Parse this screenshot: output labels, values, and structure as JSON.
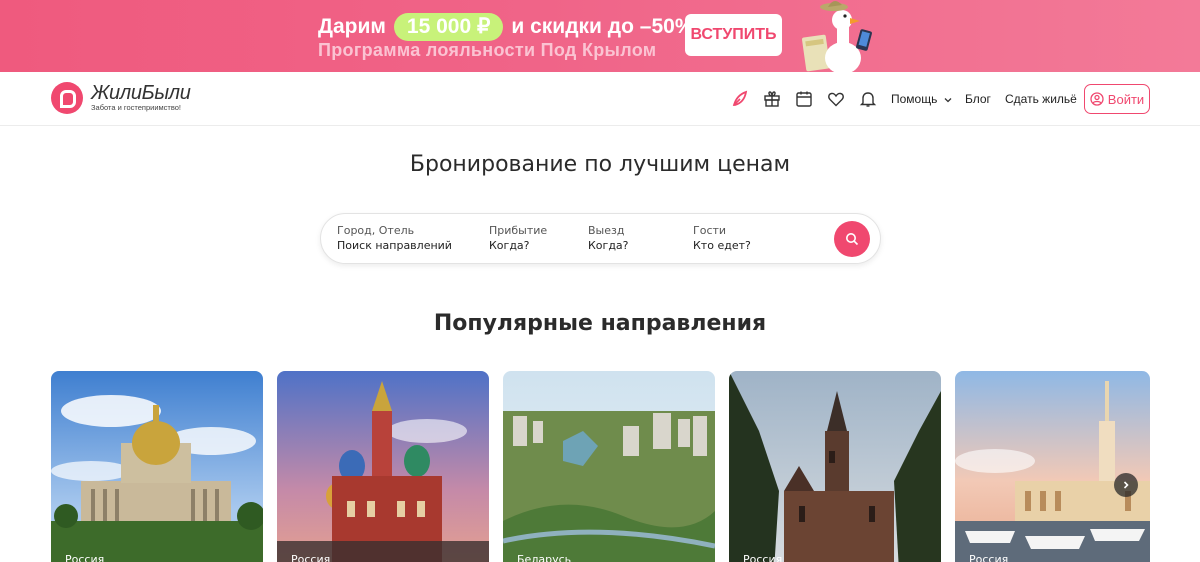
{
  "promo": {
    "prefix": "Дарим",
    "amount": "15 000 ₽",
    "suffix": "и скидки до –50%",
    "subtitle": "Программа лояльности Под Крылом",
    "button": "ВСТУПИТЬ"
  },
  "header": {
    "logo_name": "ЖилиБыли",
    "logo_tagline": "Забота и гостеприимство!",
    "icons": [
      "feather-icon",
      "gift-icon",
      "calendar-icon",
      "heart-icon",
      "bell-icon"
    ],
    "nav": {
      "help": "Помощь",
      "blog": "Блог",
      "rent_out": "Сдать жильё"
    },
    "login": "Войти"
  },
  "hero": {
    "title": "Бронирование по лучшим ценам"
  },
  "search": {
    "city_label": "Город, Отель",
    "city_value": "Поиск направлений",
    "arrival_label": "Прибытие",
    "arrival_value": "Когда?",
    "departure_label": "Выезд",
    "departure_value": "Когда?",
    "guests_label": "Гости",
    "guests_value": "Кто едет?"
  },
  "popular": {
    "title": "Популярные направления",
    "cards": [
      {
        "country": "Россия"
      },
      {
        "country": "Россия"
      },
      {
        "country": "Беларусь"
      },
      {
        "country": "Россия"
      },
      {
        "country": "Россия"
      }
    ]
  },
  "colors": {
    "brand": "#f0486f",
    "promo_pill": "#c8f27a"
  }
}
